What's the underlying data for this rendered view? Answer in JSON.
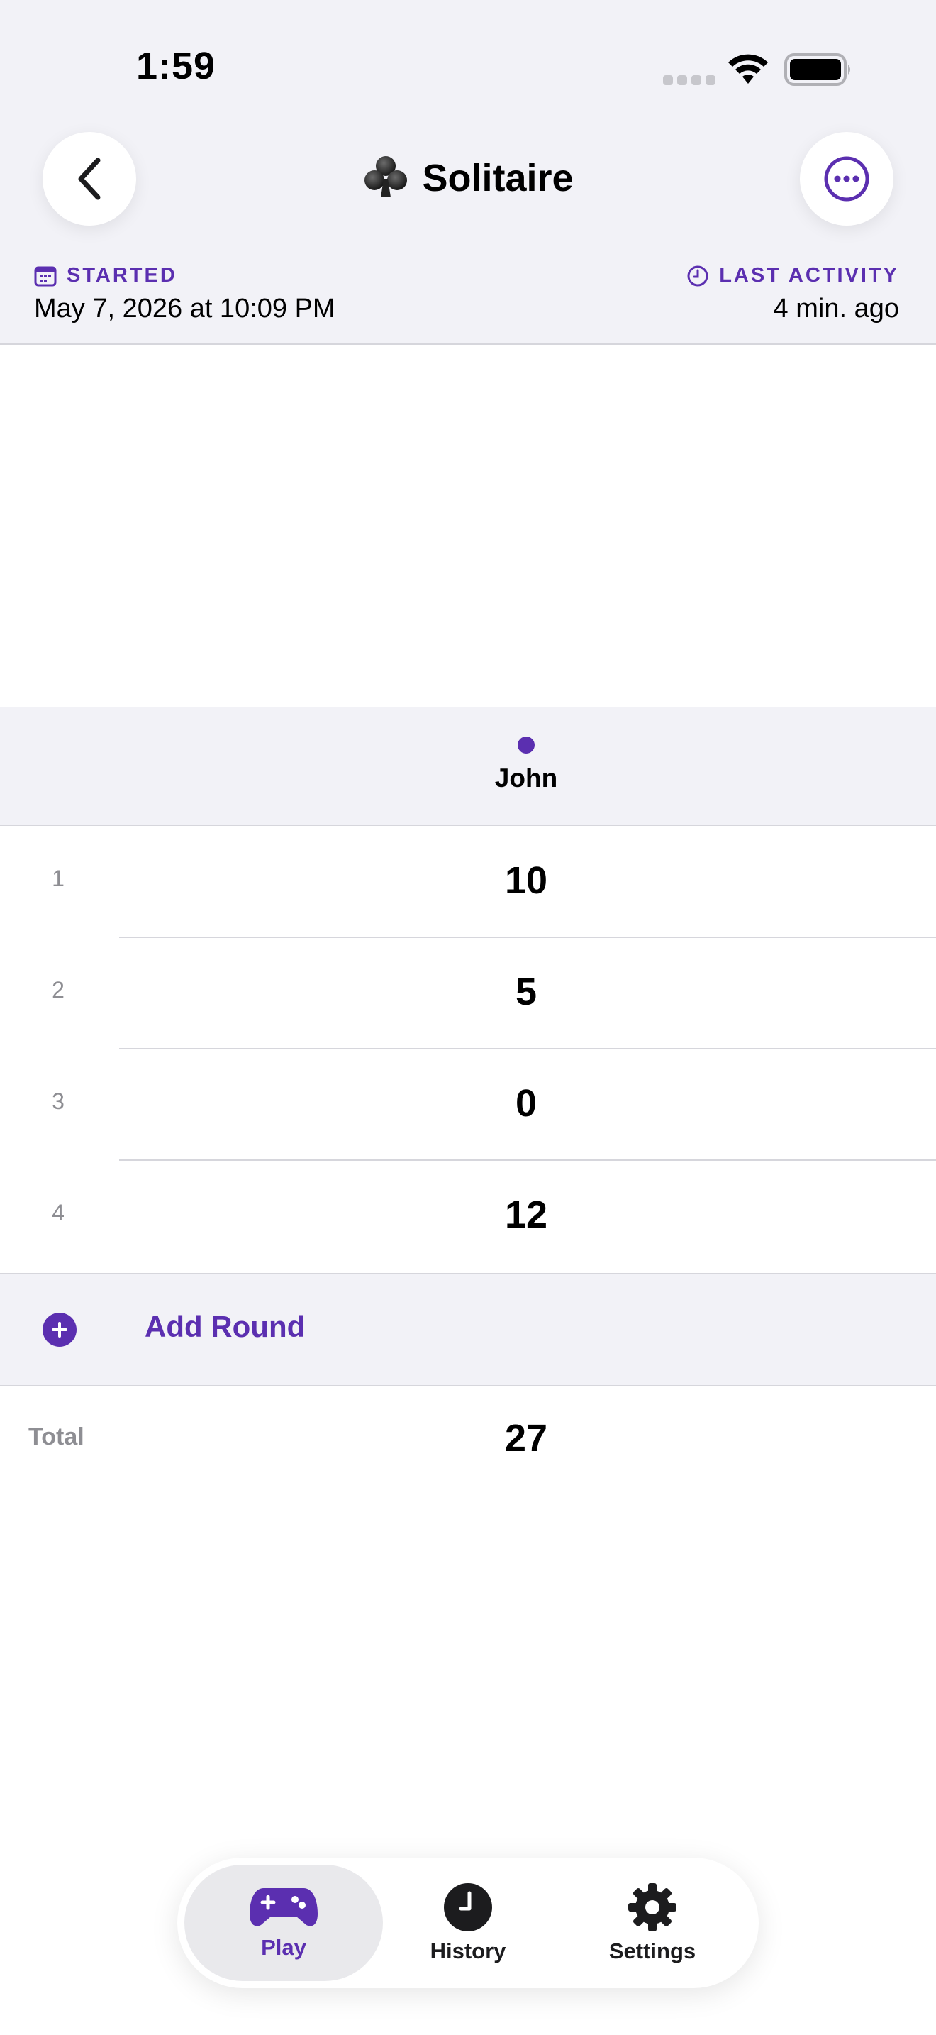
{
  "status_bar": {
    "time": "1:59"
  },
  "nav": {
    "title": "Solitaire",
    "title_icon": "club-suit-icon",
    "back_icon": "chevron-left-icon",
    "more_icon": "ellipsis-circle-icon"
  },
  "meta": {
    "started_label": "STARTED",
    "started_value": "May 7, 2026 at 10:09 PM",
    "activity_label": "LAST ACTIVITY",
    "activity_value": "4 min. ago"
  },
  "players": [
    {
      "name": "John",
      "color": "#5b2fb0"
    }
  ],
  "rounds": [
    {
      "number": "1",
      "score": "10"
    },
    {
      "number": "2",
      "score": "5"
    },
    {
      "number": "3",
      "score": "0"
    },
    {
      "number": "4",
      "score": "12"
    }
  ],
  "add_round": {
    "label": "Add Round"
  },
  "total": {
    "label": "Total",
    "value": "27"
  },
  "tabs": [
    {
      "label": "Play",
      "icon": "gamepad-icon",
      "selected": true
    },
    {
      "label": "History",
      "icon": "clock-icon",
      "selected": false
    },
    {
      "label": "Settings",
      "icon": "gear-icon",
      "selected": false
    }
  ],
  "colors": {
    "accent": "#5b2fb0",
    "background_grouped": "#f2f2f7",
    "secondary_text": "#8e8e93"
  }
}
